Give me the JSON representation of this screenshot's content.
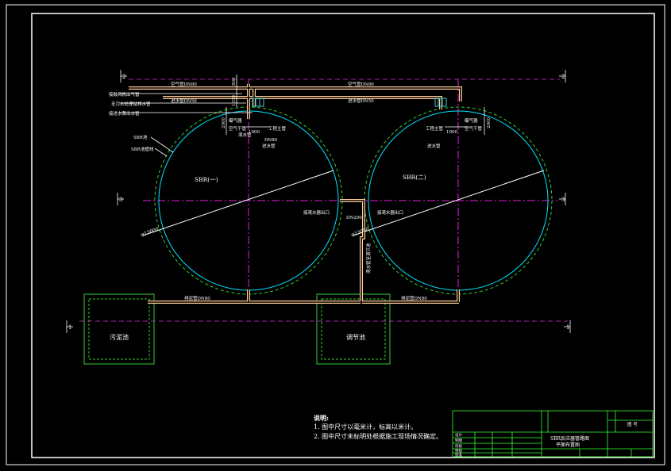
{
  "drawing": {
    "tank1_label": "SBR(一)",
    "tank2_label": "SBR(二)",
    "dia_label_1": "φ13000",
    "dia_label_2": "φ13000",
    "pool_left_label": "污泥池",
    "pool_mid_label": "调节池",
    "pipe_labels": {
      "air_main_left": "空气管DN80",
      "air_main_right": "空气管DN80",
      "inflow_left": "进水管DN50",
      "inflow_right": "进水管DN50",
      "leader_1": "接鼓风机出气管",
      "leader_2": "至污水处理站排水管",
      "leader_3": "接进水泵出水管",
      "leader_4": "SBR池",
      "leader_5": "SBR池壁线",
      "gate_l_1": "曝气器",
      "gate_l_2": "空气干管",
      "gate_l_3": "滗水管",
      "gate_l_4": "工程主管",
      "gate_l_5": "DN80",
      "gate_l_6": "进水管",
      "gate_r_1": "工程主管",
      "gate_r_2": "曝气器",
      "gate_r_3": "空气干管",
      "gate_r_4": "进水管",
      "center_1": "接滗水器出口",
      "center_2": "接滗水器出口",
      "center_3": "DN200",
      "center_vert": "滗水管至调节池",
      "sludge_left": "排泥管DN80",
      "sludge_right": "排泥管DN80"
    },
    "dims": {
      "d800": "800",
      "d1150": "1150",
      "d2000_l": "2000",
      "d1000_l": "1000",
      "d2000_r": "2000",
      "d1000_r": "1000"
    },
    "axis_marks": {
      "top_left": "2",
      "top_right": "2",
      "mid_left": "3",
      "mid_right": "3",
      "bot_left": "1",
      "bot_right": "1"
    }
  },
  "notes": {
    "title": "说明:",
    "line1": "1. 图中尺寸以毫米计，标高以米计。",
    "line2": "2. 图中尺寸未标明处根据施工现场情况确定。"
  },
  "title_block": {
    "name_line1": "SBR反应器管路图",
    "name_line2": "平面布置图",
    "right_box": "图 号",
    "row_labels": [
      "设计",
      "制图",
      "校核",
      "审核",
      "批准"
    ]
  },
  "colors": {
    "background": "#000000",
    "frame": "#ffffff",
    "tank_wall": "#00e5ff",
    "tank_dash": "#33cc33",
    "centerline": "#dd22dd",
    "pipe": "#ffcc99",
    "pipe_fill": "#000000",
    "fitting": "#44cccc",
    "title_block": "#33ff33",
    "dimension": "#ffffff"
  }
}
